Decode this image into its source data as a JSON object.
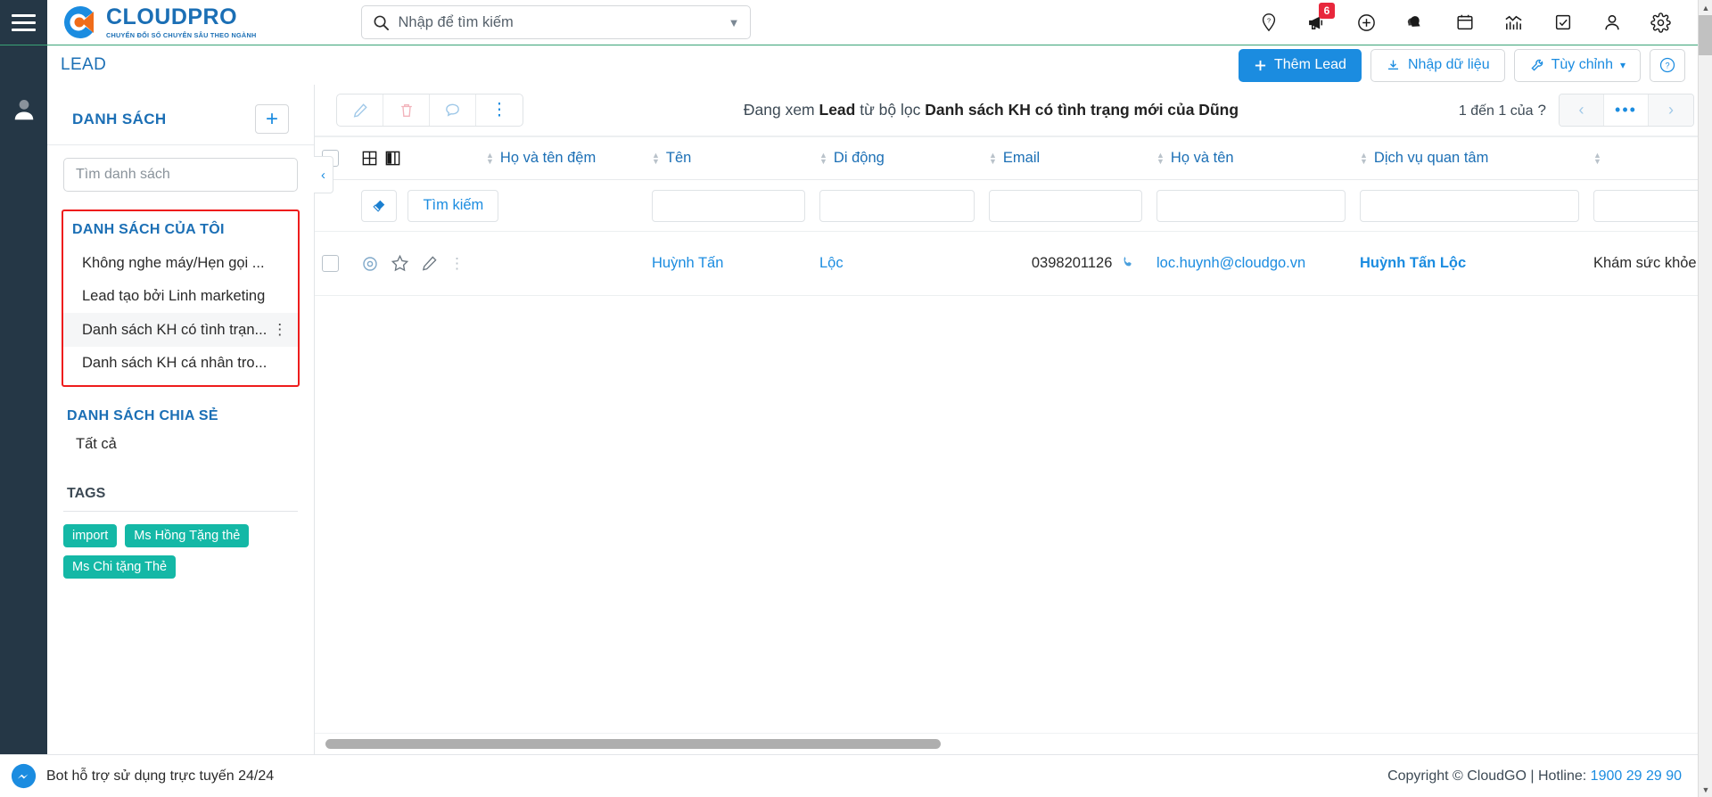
{
  "topbar": {
    "menu_icon": "hamburger-menu-icon",
    "logo": {
      "title": "CLOUDPRO",
      "subtitle": "CHUYỂN ĐỔI SỐ CHUYÊN SÂU THEO NGÀNH"
    },
    "search": {
      "placeholder": "Nhập để tìm kiếm",
      "value": ""
    },
    "icons": [
      {
        "name": "location-help-icon",
        "glyph": "pin"
      },
      {
        "name": "megaphone-icon",
        "glyph": "megaphone",
        "badge": "6"
      },
      {
        "name": "add-circle-icon",
        "glyph": "plus-circle"
      },
      {
        "name": "bell-icon",
        "glyph": "bell"
      },
      {
        "name": "calendar-icon",
        "glyph": "calendar"
      },
      {
        "name": "chart-icon",
        "glyph": "chart"
      },
      {
        "name": "task-check-icon",
        "glyph": "check-box"
      },
      {
        "name": "user-icon",
        "glyph": "user"
      },
      {
        "name": "settings-gear-icon",
        "glyph": "gear"
      }
    ]
  },
  "subbar": {
    "page_title": "LEAD",
    "add_lead": "Thêm Lead",
    "import_data": "Nhập dữ liệu",
    "customize": "Tùy chỉnh",
    "help_label": "?"
  },
  "sidebar": {
    "header": "DANH SÁCH",
    "add_button": "+",
    "search_placeholder": "Tìm danh sách",
    "my_lists_title": "DANH SÁCH CỦA TÔI",
    "my_lists": [
      {
        "label": "Không nghe máy/Hẹn gọi ...",
        "selected": false
      },
      {
        "label": "Lead tạo bởi Linh marketing",
        "selected": false
      },
      {
        "label": "Danh sách KH có tình trạn...",
        "selected": true
      },
      {
        "label": "Danh sách KH cá nhân tro...",
        "selected": false
      }
    ],
    "shared_title": "DANH SÁCH CHIA SẺ",
    "shared_items": [
      {
        "label": "Tất cả"
      }
    ],
    "tags_title": "TAGS",
    "tags": [
      "import",
      "Ms Hồng Tặng thẻ",
      "Ms Chi tặng Thẻ"
    ],
    "collapse_icon": "chevron-left-icon"
  },
  "main": {
    "toolbar": [
      {
        "name": "edit-icon"
      },
      {
        "name": "delete-icon"
      },
      {
        "name": "comment-icon"
      },
      {
        "name": "more-options-icon"
      }
    ],
    "filter_prefix": "Đang xem ",
    "filter_entity": "Lead",
    "filter_middle": " từ bộ lọc ",
    "filter_name": "Danh sách KH có tình trạng mới của Dũng",
    "pager_label": "1 đến 1 của",
    "pager_unknown": "?",
    "pager_prev": "‹",
    "pager_more": "•••",
    "pager_next": "›",
    "columns": [
      "Họ và tên đệm",
      "Tên",
      "Di động",
      "Email",
      "Họ và tên",
      "Dịch vụ quan tâm"
    ],
    "filter_row": {
      "erase_icon": "eraser-icon",
      "search_button": "Tìm kiếm",
      "inputs": [
        "",
        "",
        "",
        "",
        "",
        ""
      ]
    },
    "rows": [
      {
        "actions": [
          "view-icon",
          "star-icon",
          "edit-icon",
          "more-icon"
        ],
        "ho_va_ten_dem": "Huỳnh Tấn",
        "ten": "Lộc",
        "di_dong": "0398201126",
        "email": "loc.huynh@cloudgo.vn",
        "ho_va_ten": "Huỳnh Tấn Lộc",
        "dich_vu_quan_tam": "Khám sức khỏe doanh nghiệp"
      }
    ]
  },
  "footer": {
    "bot_label": "Bot hỗ trợ sử dụng trực tuyến 24/24",
    "copyright": "Copyright © CloudGO | Hotline: ",
    "hotline": "1900 29 29 90"
  },
  "colors": {
    "brand_blue": "#1b8ce0",
    "dark_rail": "#253746",
    "teal_tag": "#14b8a6",
    "badge_red": "#e8273c",
    "highlight_red": "#ee1c1c",
    "green_rule": "#3aa376"
  }
}
